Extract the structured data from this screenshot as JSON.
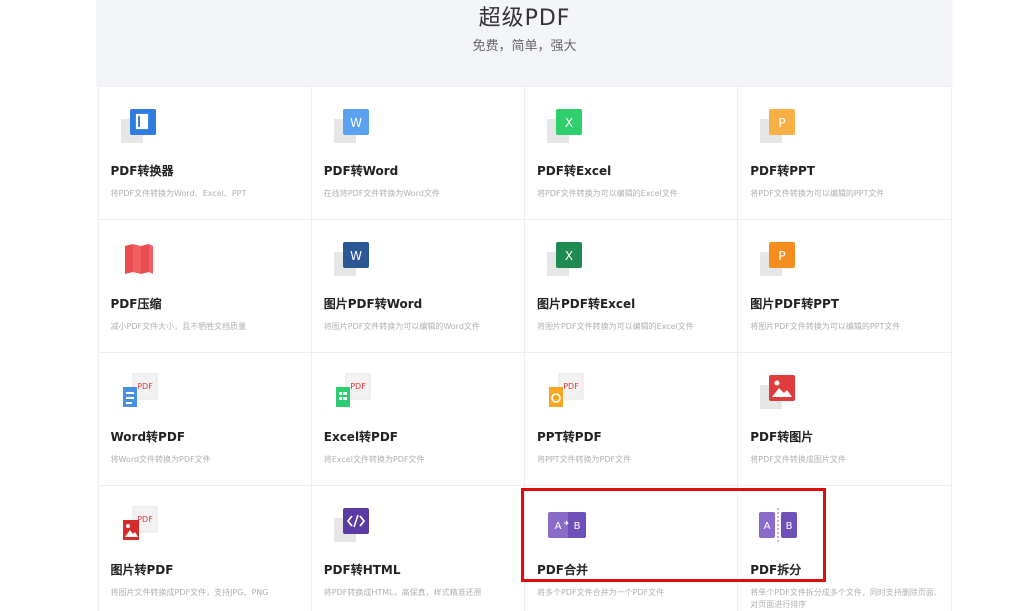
{
  "header": {
    "title": "超级PDF",
    "subtitle": "免费，简单，强大"
  },
  "colors": {
    "word": "#4a90e2",
    "word_dark": "#2b5797",
    "excel": "#2ecc71",
    "excel_dark": "#1e7a4a",
    "ppt": "#f5a623",
    "ppt_dark": "#f08a1d",
    "pdf_red": "#e03c3c",
    "purple": "#8a6cc8",
    "purple_dark": "#5b3aa6",
    "highlight": "#e30c0c"
  },
  "cards": [
    {
      "title": "PDF转换器",
      "desc": "将PDF文件转换为Word、Excel、PPT",
      "icon": "office-icon"
    },
    {
      "title": "PDF转Word",
      "desc": "在线将PDF文件转换为Word文件",
      "icon": "word-icon"
    },
    {
      "title": "PDF转Excel",
      "desc": "将PDF文件转换为可以编辑的Excel文件",
      "icon": "excel-icon"
    },
    {
      "title": "PDF转PPT",
      "desc": "将PDF文件转换为可以编辑的PPT文件",
      "icon": "ppt-icon"
    },
    {
      "title": "PDF压缩",
      "desc": "减小PDF文件大小，且不牺牲文档质量",
      "icon": "compress-icon"
    },
    {
      "title": "图片PDF转Word",
      "desc": "将图片PDF文件转换为可以编辑的Word文件",
      "icon": "word-dark-icon"
    },
    {
      "title": "图片PDF转Excel",
      "desc": "将图片PDF文件转换为可以编辑的Excel文件",
      "icon": "excel-dark-icon"
    },
    {
      "title": "图片PDF转PPT",
      "desc": "将图片PDF文件转换为可以编辑的PPT文件",
      "icon": "ppt-dark-icon"
    },
    {
      "title": "Word转PDF",
      "desc": "将Word文件转换为PDF文件",
      "icon": "word-to-pdf-icon",
      "badge": "PDF"
    },
    {
      "title": "Excel转PDF",
      "desc": "将Excel文件转换为PDF文件",
      "icon": "excel-to-pdf-icon",
      "badge": "PDF"
    },
    {
      "title": "PPT转PDF",
      "desc": "将PPT文件转换为PDF文件",
      "icon": "ppt-to-pdf-icon",
      "badge": "PDF"
    },
    {
      "title": "PDF转图片",
      "desc": "将PDF文件转换成图片文件",
      "icon": "pdf-to-image-icon"
    },
    {
      "title": "图片转PDF",
      "desc": "将图片文件转换成PDF文件，支持JPG、PNG",
      "icon": "image-to-pdf-icon",
      "badge": "PDF"
    },
    {
      "title": "PDF转HTML",
      "desc": "将PDF转换成HTML，高保真，样式精准还原",
      "icon": "html-icon"
    },
    {
      "title": "PDF合并",
      "desc": "将多个PDF文件合并为一个PDF文件",
      "icon": "merge-icon",
      "letters": [
        "A",
        "B"
      ]
    },
    {
      "title": "PDF拆分",
      "desc": "将单个PDF文件拆分成多个文件，同时支持删除页面、对页面进行排序",
      "icon": "split-icon",
      "letters": [
        "A",
        "B"
      ]
    }
  ]
}
